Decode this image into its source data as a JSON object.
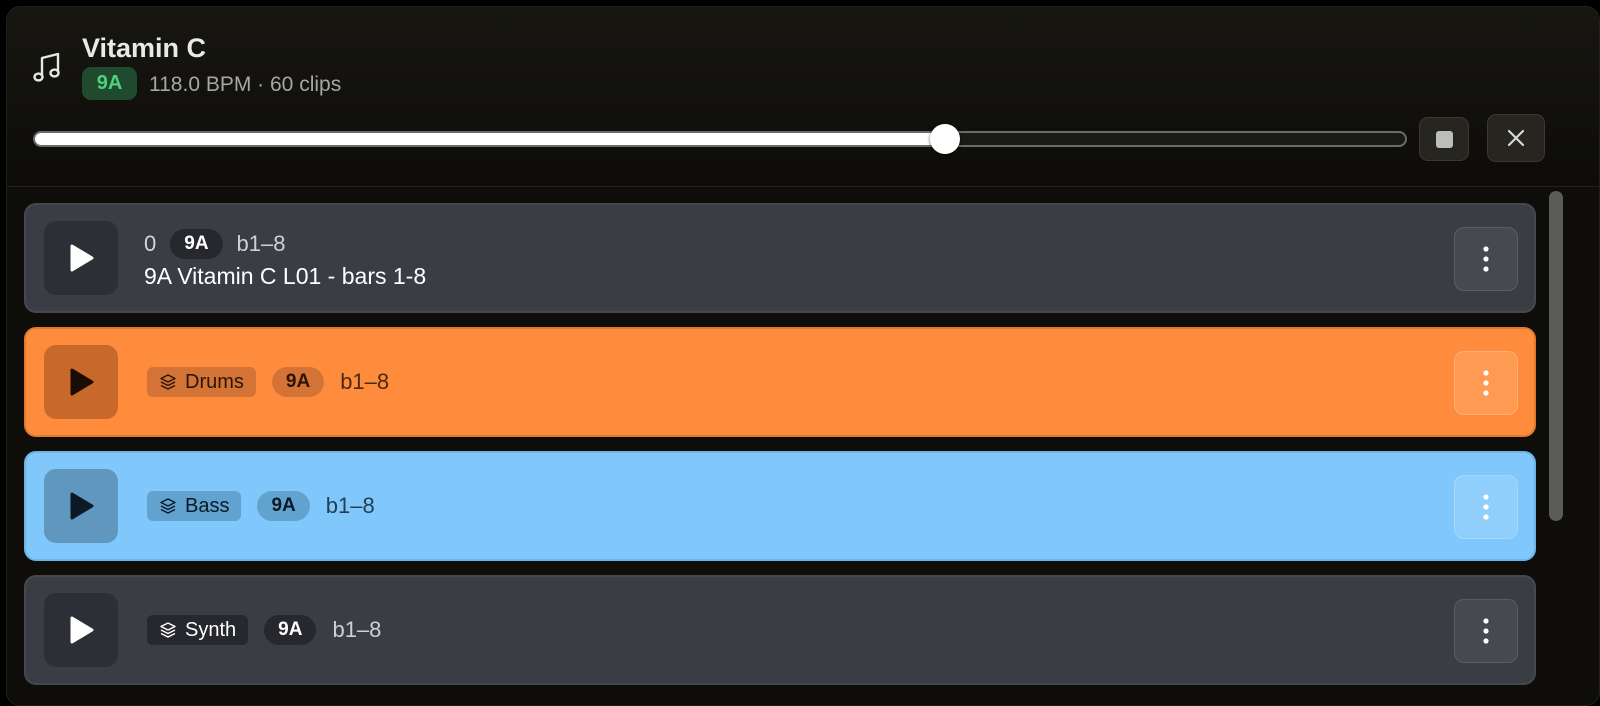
{
  "player": {
    "title": "Vitamin C",
    "key": "9A",
    "meta": "118.0 BPM · 60 clips",
    "progress": 0.664,
    "icons": {
      "music": "music-note-icon",
      "stop": "stop-icon",
      "close": "close-icon"
    }
  },
  "clips": [
    {
      "index": "0",
      "key": "9A",
      "bars": "b1–8",
      "name": "9A Vitamin C L01 - bars 1-8",
      "color": "#3a3d44"
    },
    {
      "stem": "Drums",
      "key": "9A",
      "bars": "b1–8",
      "color": "#ff8c3d"
    },
    {
      "stem": "Bass",
      "key": "9A",
      "bars": "b1–8",
      "color": "#80c8fb"
    },
    {
      "stem": "Synth",
      "key": "9A",
      "bars": "b1–8",
      "color": "#3a3d44"
    }
  ],
  "accent": {
    "key_badge_text": "#4fd07c",
    "key_badge_bg": "#1f4a2d"
  }
}
